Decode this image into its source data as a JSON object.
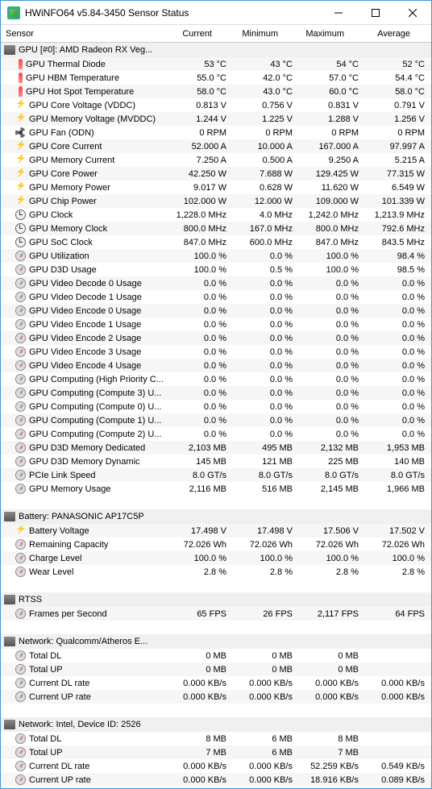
{
  "window": {
    "title": "HWiNFO64 v5.84-3450 Sensor Status"
  },
  "columns": {
    "sensor": "Sensor",
    "current": "Current",
    "minimum": "Minimum",
    "maximum": "Maximum",
    "average": "Average"
  },
  "groups": [
    {
      "label": "GPU [#0]: AMD Radeon RX Veg...",
      "rows": [
        {
          "icon": "temp",
          "label": "GPU Thermal Diode",
          "cur": "53 °C",
          "min": "43 °C",
          "max": "54 °C",
          "avg": "52 °C"
        },
        {
          "icon": "temp",
          "label": "GPU HBM Temperature",
          "cur": "55.0 °C",
          "min": "42.0 °C",
          "max": "57.0 °C",
          "avg": "54.4 °C"
        },
        {
          "icon": "temp",
          "label": "GPU Hot Spot Temperature",
          "cur": "58.0 °C",
          "min": "43.0 °C",
          "max": "60.0 °C",
          "avg": "58.0 °C"
        },
        {
          "icon": "bolt",
          "label": "GPU Core Voltage (VDDC)",
          "cur": "0.813 V",
          "min": "0.756 V",
          "max": "0.831 V",
          "avg": "0.791 V"
        },
        {
          "icon": "bolt",
          "label": "GPU Memory Voltage (MVDDC)",
          "cur": "1.244 V",
          "min": "1.225 V",
          "max": "1.288 V",
          "avg": "1.256 V"
        },
        {
          "icon": "fan",
          "label": "GPU Fan (ODN)",
          "cur": "0 RPM",
          "min": "0 RPM",
          "max": "0 RPM",
          "avg": "0 RPM"
        },
        {
          "icon": "bolt",
          "label": "GPU Core Current",
          "cur": "52.000 A",
          "min": "10.000 A",
          "max": "167.000 A",
          "avg": "97.997 A"
        },
        {
          "icon": "bolt",
          "label": "GPU Memory Current",
          "cur": "7.250 A",
          "min": "0.500 A",
          "max": "9.250 A",
          "avg": "5.215 A"
        },
        {
          "icon": "bolt",
          "label": "GPU Core Power",
          "cur": "42.250 W",
          "min": "7.688 W",
          "max": "129.425 W",
          "avg": "77.315 W"
        },
        {
          "icon": "bolt",
          "label": "GPU Memory Power",
          "cur": "9.017 W",
          "min": "0.628 W",
          "max": "11.620 W",
          "avg": "6.549 W"
        },
        {
          "icon": "bolt",
          "label": "GPU Chip Power",
          "cur": "102.000 W",
          "min": "12.000 W",
          "max": "109.000 W",
          "avg": "101.339 W"
        },
        {
          "icon": "clock",
          "label": "GPU Clock",
          "cur": "1,228.0 MHz",
          "min": "4.0 MHz",
          "max": "1,242.0 MHz",
          "avg": "1,213.9 MHz"
        },
        {
          "icon": "clock",
          "label": "GPU Memory Clock",
          "cur": "800.0 MHz",
          "min": "167.0 MHz",
          "max": "800.0 MHz",
          "avg": "792.6 MHz"
        },
        {
          "icon": "clock",
          "label": "GPU SoC Clock",
          "cur": "847.0 MHz",
          "min": "600.0 MHz",
          "max": "847.0 MHz",
          "avg": "843.5 MHz"
        },
        {
          "icon": "dash",
          "label": "GPU Utilization",
          "cur": "100.0 %",
          "min": "0.0 %",
          "max": "100.0 %",
          "avg": "98.4 %"
        },
        {
          "icon": "dash",
          "label": "GPU D3D Usage",
          "cur": "100.0 %",
          "min": "0.5 %",
          "max": "100.0 %",
          "avg": "98.5 %"
        },
        {
          "icon": "dash",
          "label": "GPU Video Decode 0 Usage",
          "cur": "0.0 %",
          "min": "0.0 %",
          "max": "0.0 %",
          "avg": "0.0 %"
        },
        {
          "icon": "dash",
          "label": "GPU Video Decode 1 Usage",
          "cur": "0.0 %",
          "min": "0.0 %",
          "max": "0.0 %",
          "avg": "0.0 %"
        },
        {
          "icon": "dash",
          "label": "GPU Video Encode 0 Usage",
          "cur": "0.0 %",
          "min": "0.0 %",
          "max": "0.0 %",
          "avg": "0.0 %"
        },
        {
          "icon": "dash",
          "label": "GPU Video Encode 1 Usage",
          "cur": "0.0 %",
          "min": "0.0 %",
          "max": "0.0 %",
          "avg": "0.0 %"
        },
        {
          "icon": "dash",
          "label": "GPU Video Encode 2 Usage",
          "cur": "0.0 %",
          "min": "0.0 %",
          "max": "0.0 %",
          "avg": "0.0 %"
        },
        {
          "icon": "dash",
          "label": "GPU Video Encode 3 Usage",
          "cur": "0.0 %",
          "min": "0.0 %",
          "max": "0.0 %",
          "avg": "0.0 %"
        },
        {
          "icon": "dash",
          "label": "GPU Video Encode 4 Usage",
          "cur": "0.0 %",
          "min": "0.0 %",
          "max": "0.0 %",
          "avg": "0.0 %"
        },
        {
          "icon": "dash",
          "label": "GPU Computing (High Priority C...",
          "cur": "0.0 %",
          "min": "0.0 %",
          "max": "0.0 %",
          "avg": "0.0 %"
        },
        {
          "icon": "dash",
          "label": "GPU Computing (Compute 3) U...",
          "cur": "0.0 %",
          "min": "0.0 %",
          "max": "0.0 %",
          "avg": "0.0 %"
        },
        {
          "icon": "dash",
          "label": "GPU Computing (Compute 0) U...",
          "cur": "0.0 %",
          "min": "0.0 %",
          "max": "0.0 %",
          "avg": "0.0 %"
        },
        {
          "icon": "dash",
          "label": "GPU Computing (Compute 1) U...",
          "cur": "0.0 %",
          "min": "0.0 %",
          "max": "0.0 %",
          "avg": "0.0 %"
        },
        {
          "icon": "dash",
          "label": "GPU Computing (Compute 2) U...",
          "cur": "0.0 %",
          "min": "0.0 %",
          "max": "0.0 %",
          "avg": "0.0 %"
        },
        {
          "icon": "dash",
          "label": "GPU D3D Memory Dedicated",
          "cur": "2,103 MB",
          "min": "495 MB",
          "max": "2,132 MB",
          "avg": "1,953 MB"
        },
        {
          "icon": "dash",
          "label": "GPU D3D Memory Dynamic",
          "cur": "145 MB",
          "min": "121 MB",
          "max": "225 MB",
          "avg": "140 MB"
        },
        {
          "icon": "dash",
          "label": "PCIe Link Speed",
          "cur": "8.0 GT/s",
          "min": "8.0 GT/s",
          "max": "8.0 GT/s",
          "avg": "8.0 GT/s"
        },
        {
          "icon": "dash",
          "label": "GPU Memory Usage",
          "cur": "2,116 MB",
          "min": "516 MB",
          "max": "2,145 MB",
          "avg": "1,966 MB"
        }
      ]
    },
    {
      "label": "Battery: PANASONIC AP17C5P",
      "rows": [
        {
          "icon": "bolt",
          "label": "Battery Voltage",
          "cur": "17.498 V",
          "min": "17.498 V",
          "max": "17.506 V",
          "avg": "17.502 V"
        },
        {
          "icon": "dash",
          "label": "Remaining Capacity",
          "cur": "72.026 Wh",
          "min": "72.026 Wh",
          "max": "72.026 Wh",
          "avg": "72.026 Wh"
        },
        {
          "icon": "dash",
          "label": "Charge Level",
          "cur": "100.0 %",
          "min": "100.0 %",
          "max": "100.0 %",
          "avg": "100.0 %"
        },
        {
          "icon": "dash",
          "label": "Wear Level",
          "cur": "2.8 %",
          "min": "2.8 %",
          "max": "2.8 %",
          "avg": "2.8 %"
        }
      ]
    },
    {
      "label": "RTSS",
      "rows": [
        {
          "icon": "dash",
          "label": "Frames per Second",
          "cur": "65 FPS",
          "min": "26 FPS",
          "max": "2,117 FPS",
          "avg": "64 FPS"
        }
      ]
    },
    {
      "label": "Network: Qualcomm/Atheros E...",
      "rows": [
        {
          "icon": "dash",
          "label": "Total DL",
          "cur": "0 MB",
          "min": "0 MB",
          "max": "0 MB",
          "avg": ""
        },
        {
          "icon": "dash",
          "label": "Total UP",
          "cur": "0 MB",
          "min": "0 MB",
          "max": "0 MB",
          "avg": ""
        },
        {
          "icon": "dash",
          "label": "Current DL rate",
          "cur": "0.000 KB/s",
          "min": "0.000 KB/s",
          "max": "0.000 KB/s",
          "avg": "0.000 KB/s"
        },
        {
          "icon": "dash",
          "label": "Current UP rate",
          "cur": "0.000 KB/s",
          "min": "0.000 KB/s",
          "max": "0.000 KB/s",
          "avg": "0.000 KB/s"
        }
      ]
    },
    {
      "label": "Network: Intel, Device ID: 2526",
      "rows": [
        {
          "icon": "dash",
          "label": "Total DL",
          "cur": "8 MB",
          "min": "6 MB",
          "max": "8 MB",
          "avg": ""
        },
        {
          "icon": "dash",
          "label": "Total UP",
          "cur": "7 MB",
          "min": "6 MB",
          "max": "7 MB",
          "avg": ""
        },
        {
          "icon": "dash",
          "label": "Current DL rate",
          "cur": "0.000 KB/s",
          "min": "0.000 KB/s",
          "max": "52.259 KB/s",
          "avg": "0.549 KB/s"
        },
        {
          "icon": "dash",
          "label": "Current UP rate",
          "cur": "0.000 KB/s",
          "min": "0.000 KB/s",
          "max": "18.916 KB/s",
          "avg": "0.089 KB/s"
        }
      ]
    }
  ]
}
